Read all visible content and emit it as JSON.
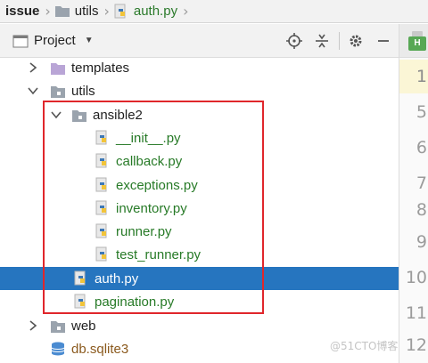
{
  "breadcrumb": [
    {
      "label": "issue",
      "icon": "folder-icon"
    },
    {
      "label": "utils",
      "icon": "folder-icon"
    },
    {
      "label": "auth.py",
      "icon": "python-file-icon"
    }
  ],
  "project_panel": {
    "title": "Project",
    "toolbar_icons": [
      "locate-icon",
      "collapse-icon",
      "gear-icon",
      "minimize-icon"
    ]
  },
  "editor_gutter": {
    "line_numbers": [
      "1",
      "5",
      "6",
      "7",
      "8",
      "9",
      "10",
      "11",
      "12"
    ],
    "active_line": "1"
  },
  "tree": [
    {
      "label": "templates",
      "type": "folder",
      "expanded": false,
      "color": "dark"
    },
    {
      "label": "utils",
      "type": "folder",
      "expanded": true,
      "color": "dark"
    },
    {
      "label": "ansible2",
      "type": "folder",
      "expanded": true,
      "color": "dark"
    },
    {
      "label": "__init__.py",
      "type": "python-file",
      "color": "green"
    },
    {
      "label": "callback.py",
      "type": "python-file",
      "color": "green"
    },
    {
      "label": "exceptions.py",
      "type": "python-file",
      "color": "green"
    },
    {
      "label": "inventory.py",
      "type": "python-file",
      "color": "green"
    },
    {
      "label": "runner.py",
      "type": "python-file",
      "color": "green"
    },
    {
      "label": "test_runner.py",
      "type": "python-file",
      "color": "green"
    },
    {
      "label": "auth.py",
      "type": "python-file",
      "color": "dark",
      "selected": true
    },
    {
      "label": "pagination.py",
      "type": "python-file",
      "color": "green"
    },
    {
      "label": "web",
      "type": "folder",
      "expanded": false,
      "color": "dark"
    },
    {
      "label": "db.sqlite3",
      "type": "database-file",
      "color": "brown"
    }
  ],
  "watermark": "@51CTO博客",
  "colors": {
    "selection": "#2675bf",
    "highlight_box": "#e0262b",
    "python_file_text": "#277a27",
    "db_file_text": "#8b5a1e"
  }
}
